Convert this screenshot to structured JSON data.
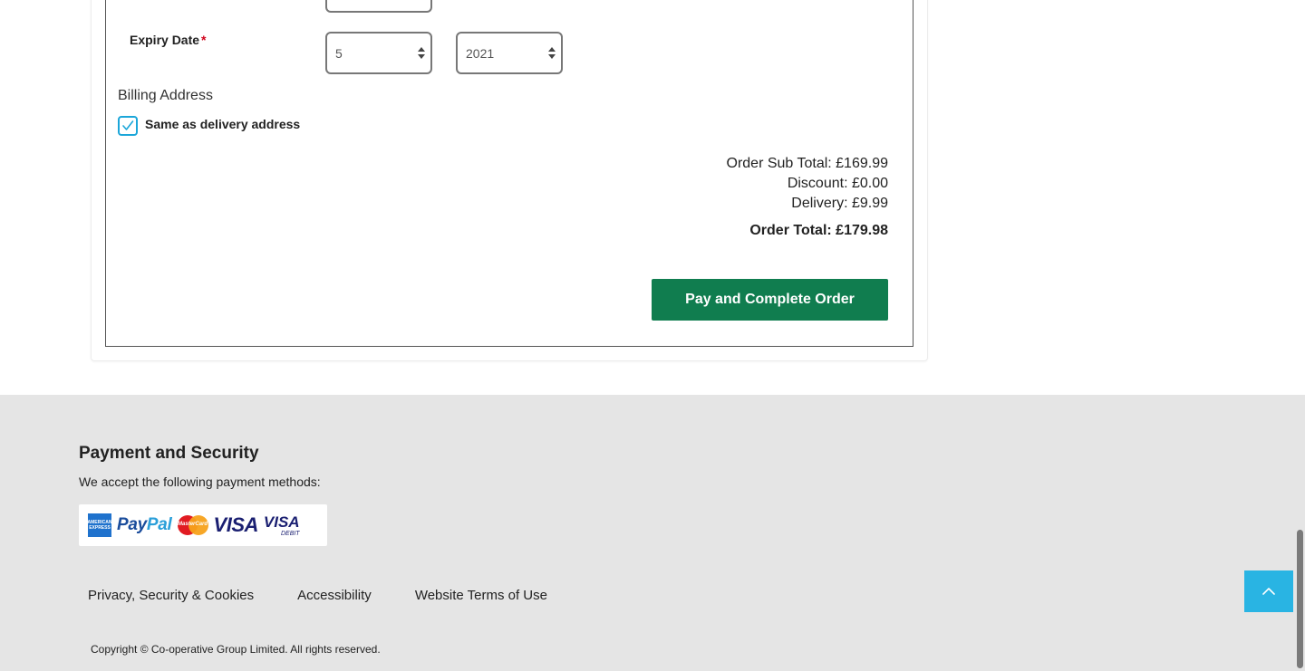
{
  "payment_form": {
    "expiry_label": "Expiry Date",
    "required_marker": "*",
    "expiry_month": "5",
    "expiry_year": "2021"
  },
  "billing": {
    "title": "Billing Address",
    "same_as_delivery_label": "Same as delivery address",
    "same_as_delivery_checked": true
  },
  "summary": {
    "sub_total": "Order Sub Total: £169.99",
    "discount": "Discount: £0.00",
    "delivery": "Delivery: £9.99",
    "order_total": "Order Total: £179.98"
  },
  "actions": {
    "pay_label": "Pay and Complete Order",
    "pay_color": "#107d4f"
  },
  "footer": {
    "title": "Payment and Security",
    "subtitle": "We accept the following payment methods:",
    "payment_methods": [
      "american-express-icon",
      "paypal-icon",
      "mastercard-icon",
      "visa-icon",
      "visa-debit-icon"
    ],
    "amex_text": "AMERICAN EXPRESS",
    "paypal_pay": "Pay",
    "paypal_pal": "Pal",
    "mastercard_text": "MasterCard",
    "visa_text": "VISA",
    "visa_debit_v": "VISA",
    "visa_debit_d": "DEBIT",
    "links": [
      "Privacy, Security & Cookies",
      "Accessibility",
      "Website Terms of Use"
    ],
    "copyright": "Copyright © Co-operative Group Limited. All rights reserved."
  },
  "colors": {
    "accent": "#29b4e3",
    "checkbox": "#1ba6d9",
    "footer_bg": "#e5e5e5"
  }
}
